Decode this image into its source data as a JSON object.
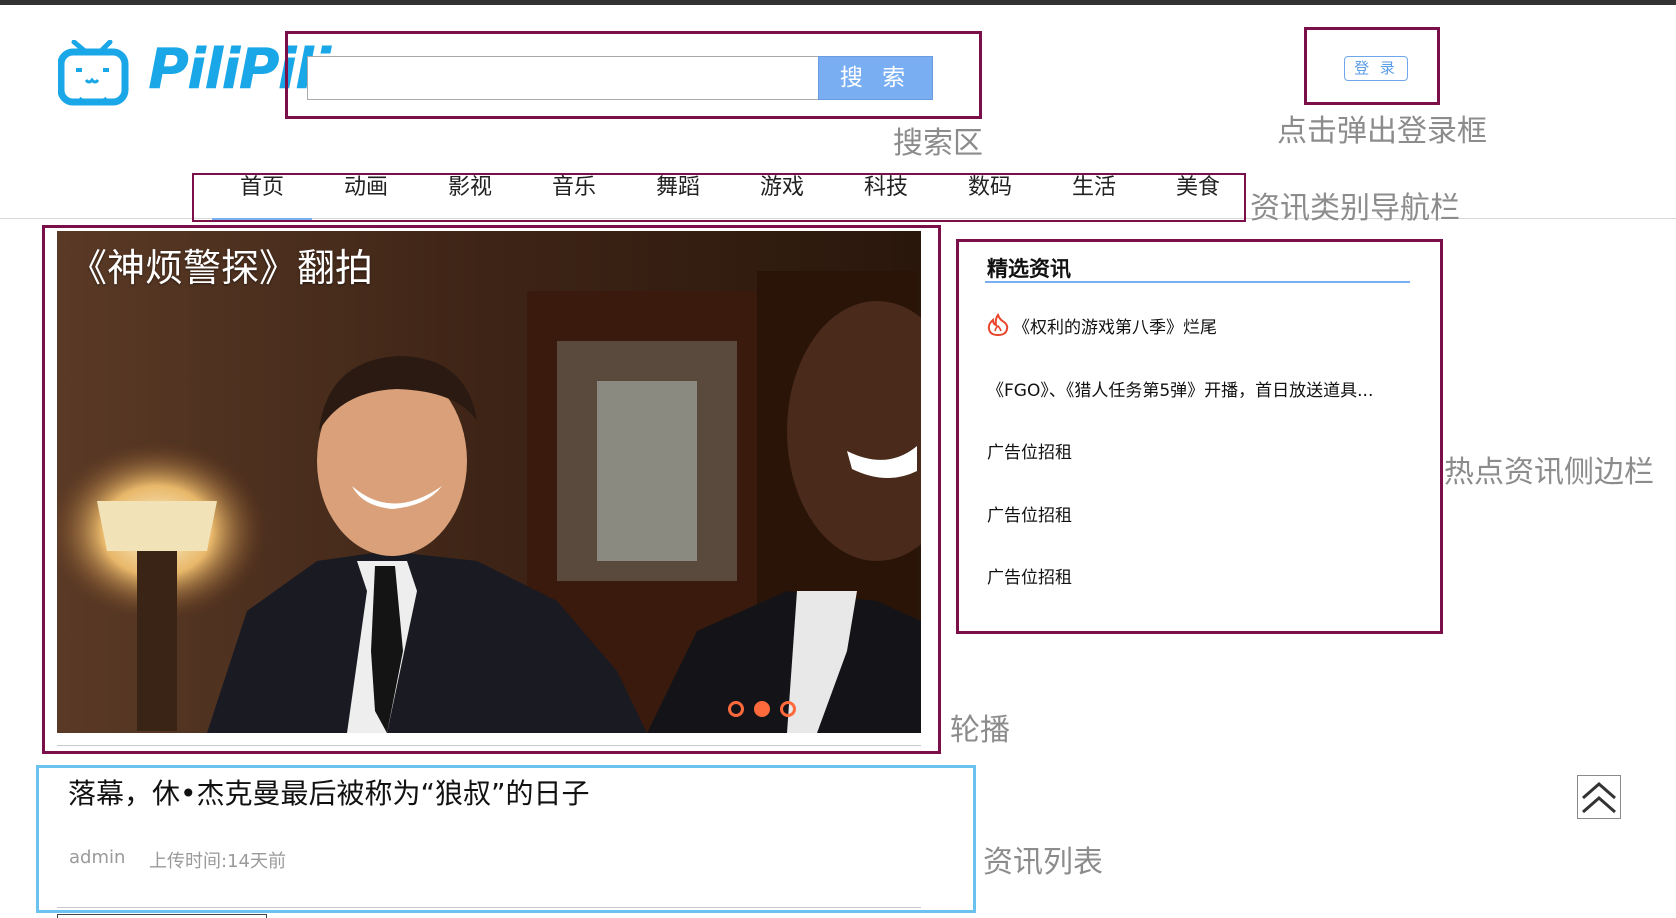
{
  "logo": {
    "text": "PiliPili",
    "mascot_icon": "tv-mascot-icon",
    "color": "#1aa7e8"
  },
  "search": {
    "button_label": "搜 索",
    "value": ""
  },
  "login": {
    "label": "登 录"
  },
  "nav": {
    "items": [
      "首页",
      "动画",
      "影视",
      "音乐",
      "舞蹈",
      "游戏",
      "科技",
      "数码",
      "生活",
      "美食"
    ],
    "active_index": 0
  },
  "carousel": {
    "title": "《神烦警探》翻拍",
    "dots": 3,
    "active_dot": 1
  },
  "sidebar": {
    "title": "精选资讯",
    "items": [
      {
        "text": "《权利的游戏第八季》烂尾",
        "icon": "hot-flame-icon"
      },
      {
        "text": "《FGO》、《猎人任务第5弹》开播，首日放送道具..."
      },
      {
        "text": "广告位招租"
      },
      {
        "text": "广告位招租"
      },
      {
        "text": "广告位招租"
      }
    ]
  },
  "news": [
    {
      "title": "落幕，休•杰克曼最后被称为“狼叔”的日子",
      "author": "admin",
      "time": "上传时间:14天前"
    }
  ],
  "annotations": {
    "search_area": "搜索区",
    "login_popup": "点击弹出登录框",
    "category_nav": "资讯类别导航栏",
    "hot_sidebar": "热点资讯侧边栏",
    "carousel": "轮播",
    "news_list": "资讯列表"
  },
  "colors": {
    "accent_blue": "#79aef2",
    "frame": "#7a0f4a",
    "news_frame": "#6cc2ee",
    "dot": "#ff6a3d"
  }
}
